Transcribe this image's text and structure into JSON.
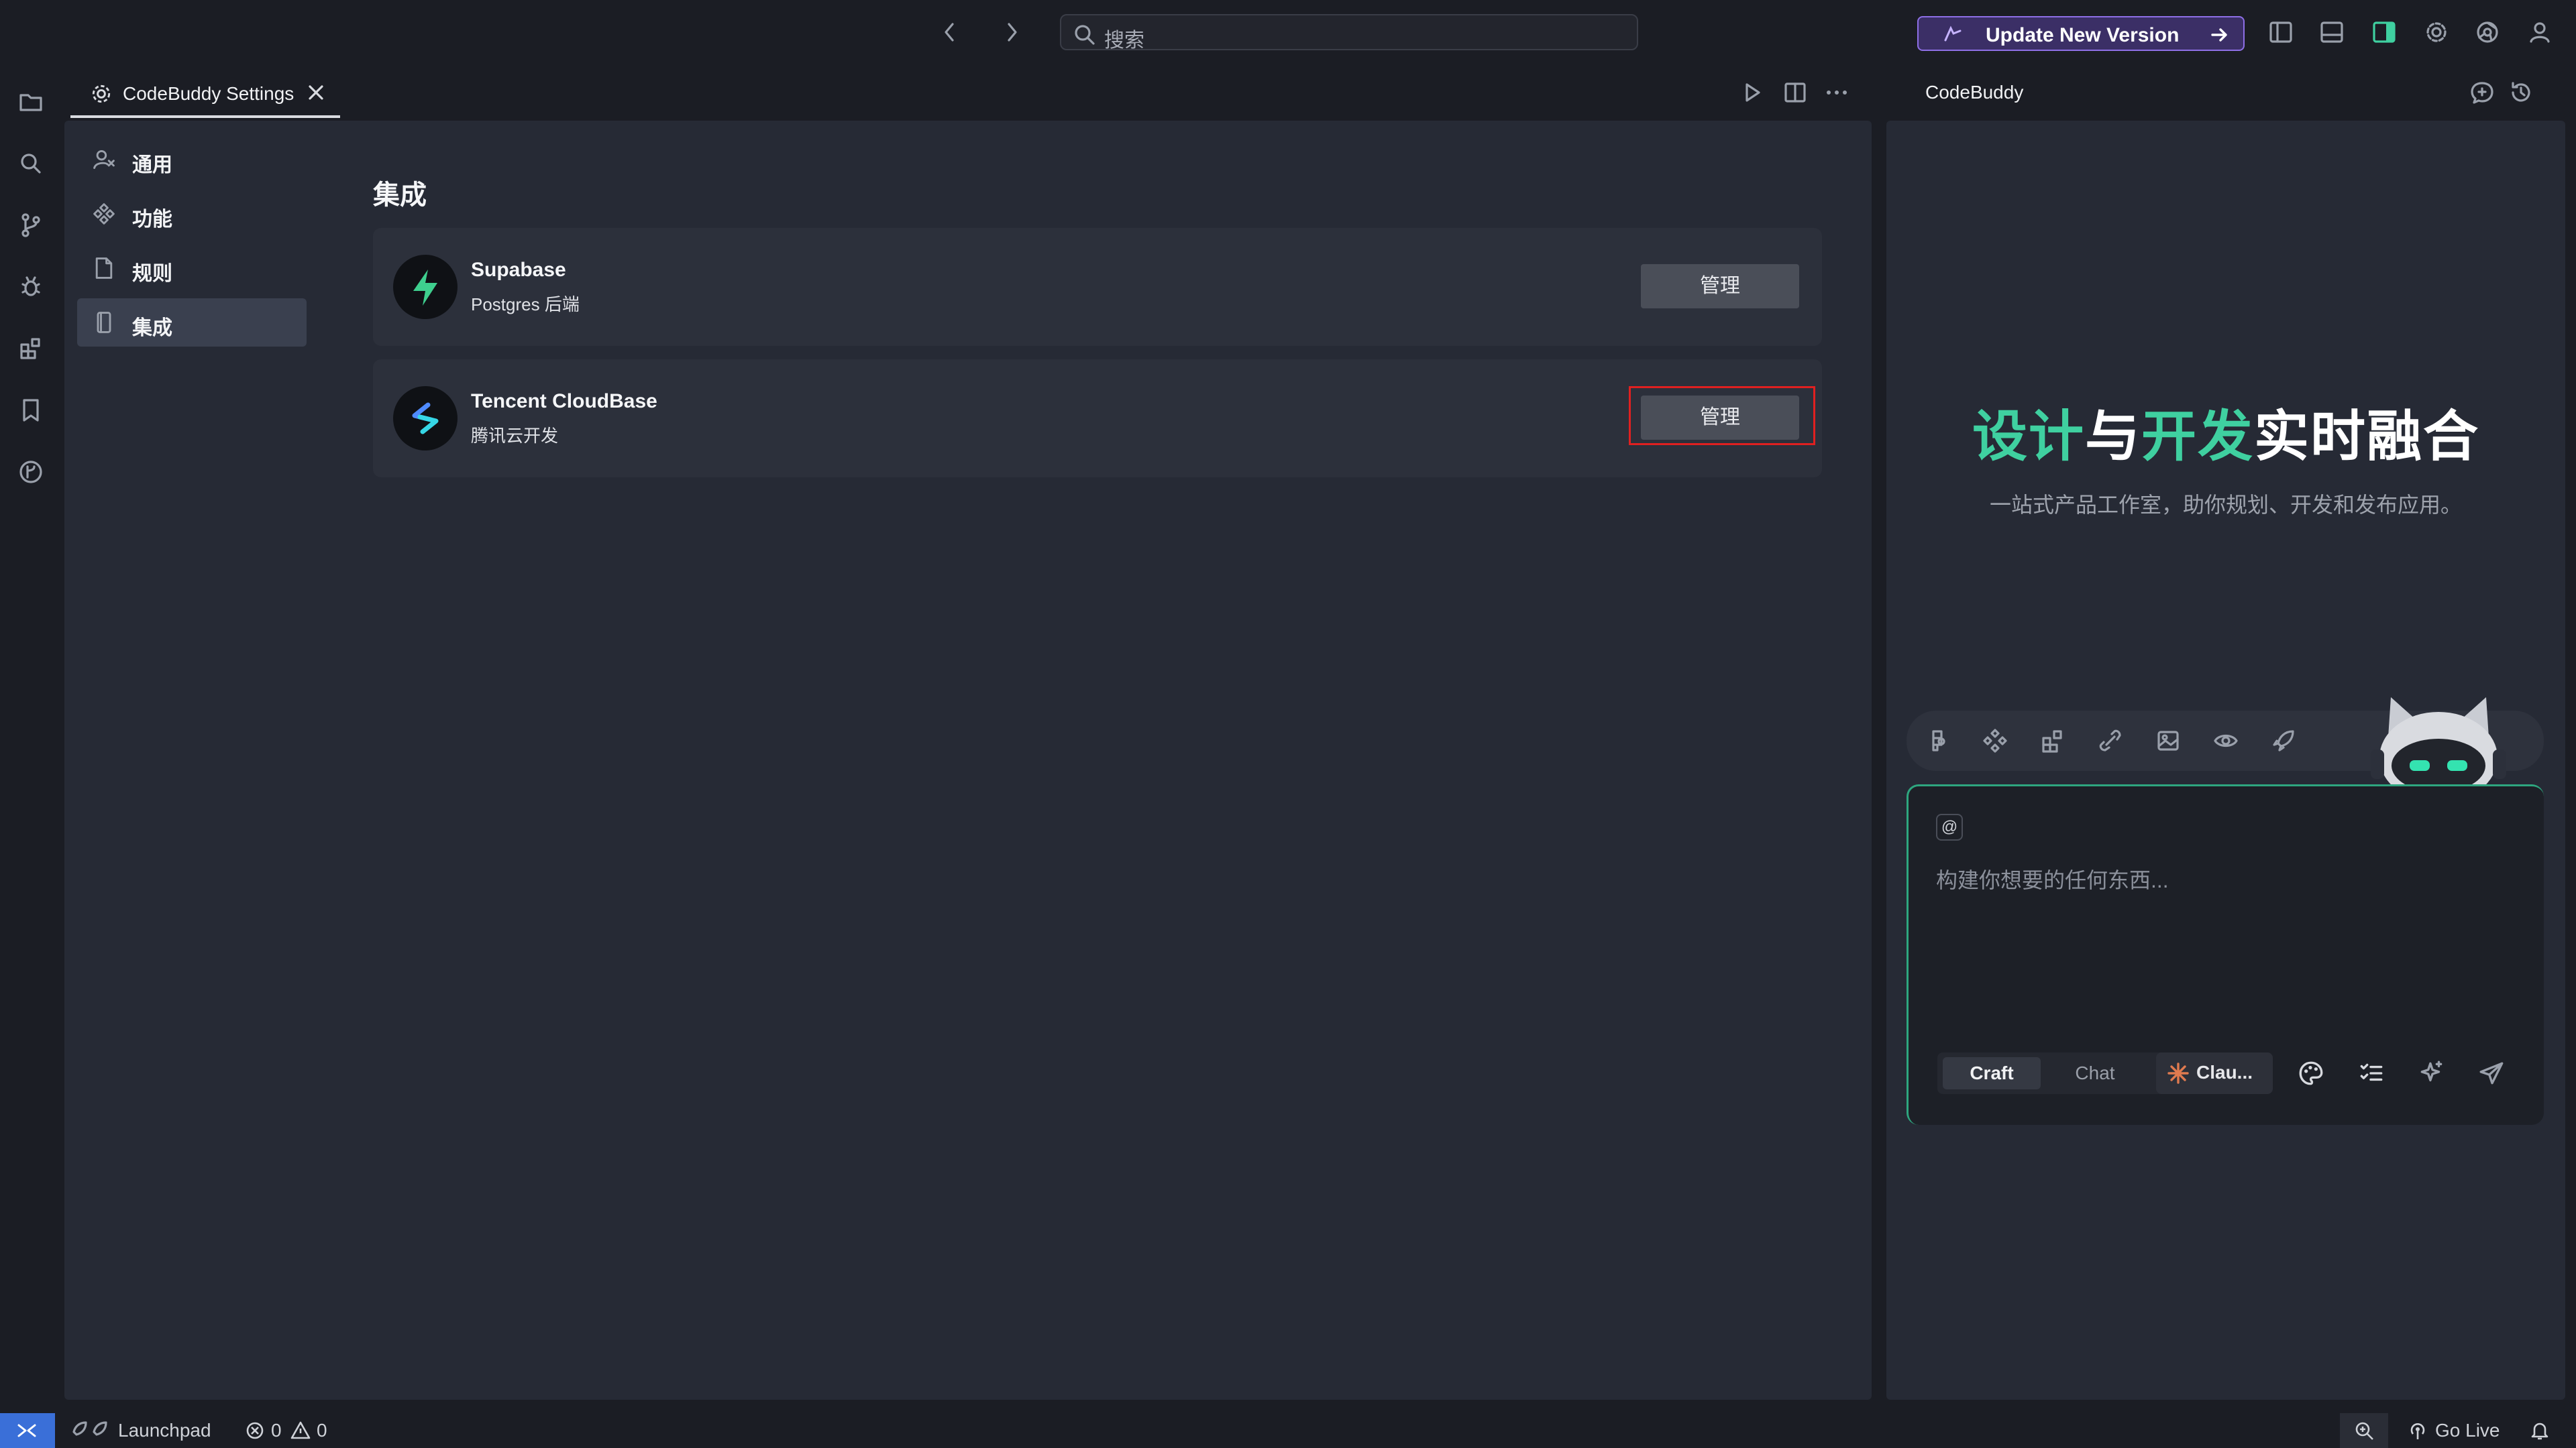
{
  "titlebar": {
    "search_placeholder": "搜索",
    "update_button": "Update New Version"
  },
  "editor": {
    "tab_label": "CodeBuddy Settings"
  },
  "settings": {
    "nav": [
      {
        "label": "通用",
        "icon": "user-settings-icon"
      },
      {
        "label": "功能",
        "icon": "feature-icon"
      },
      {
        "label": "规则",
        "icon": "file-icon"
      },
      {
        "label": "集成",
        "icon": "integration-icon"
      }
    ],
    "active_nav": "集成",
    "section_title": "集成",
    "integrations": [
      {
        "name": "Supabase",
        "description": "Postgres 后端",
        "button": "管理"
      },
      {
        "name": "Tencent CloudBase",
        "description": "腾讯云开发",
        "button": "管理"
      }
    ]
  },
  "right_panel": {
    "title": "CodeBuddy",
    "hero_title_parts": [
      "设计",
      "与",
      "开发",
      "实时融合"
    ],
    "hero_subtitle": "一站式产品工作室，助你规划、开发和发布应用。",
    "composer_placeholder": "构建你想要的任何东西...",
    "mention_symbol": "@",
    "mode_craft": "Craft",
    "mode_chat": "Chat",
    "model_label": "Clau..."
  },
  "statusbar": {
    "launchpad": "Launchpad",
    "errors": "0",
    "warnings": "0",
    "go_live": "Go Live"
  },
  "colors": {
    "accent_green": "#3fd0a0",
    "highlight_red": "#e02020",
    "update_purple": "#8e6fe6",
    "remote_blue": "#3a6fd8"
  }
}
